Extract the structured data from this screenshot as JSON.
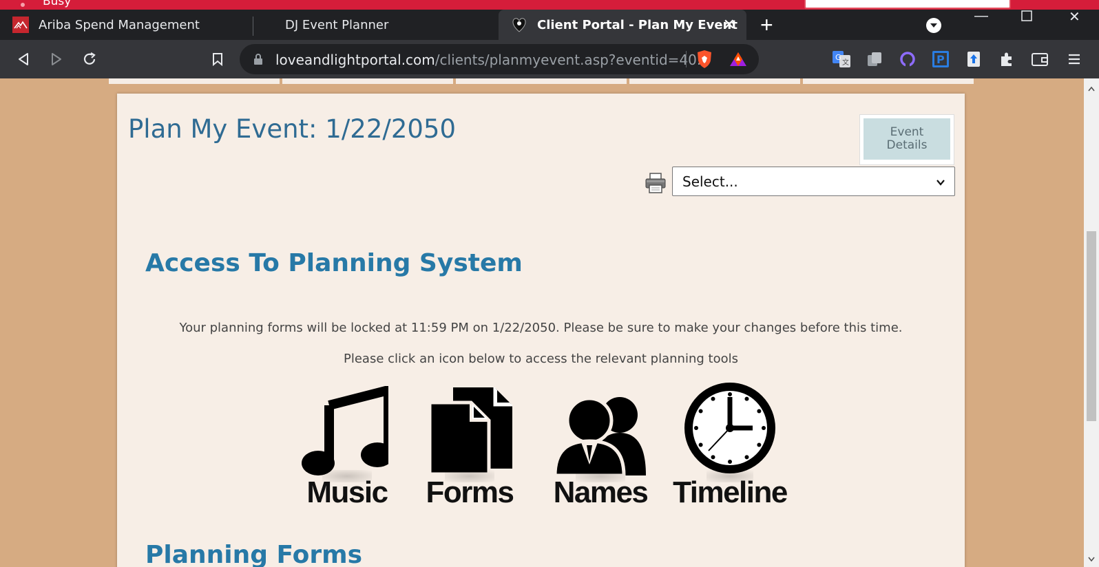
{
  "os_bar": {
    "busy_label": "Busy"
  },
  "tabs": [
    {
      "label": "Ariba Spend Management",
      "icon": "ariba-favicon"
    },
    {
      "label": "DJ Event Planner",
      "icon": "none"
    },
    {
      "label": "Client Portal - Plan My Event",
      "icon": "portal-favicon",
      "active": true
    }
  ],
  "toolbar": {
    "url_host": "loveandlightportal.com",
    "url_path": "/clients/planmyevent.asp?eventid=40..."
  },
  "page": {
    "title": "Plan My Event: 1/22/2050",
    "event_details_button": "Event Details",
    "select_value": "Select...",
    "section_title": "Access To Planning System",
    "lock_message": "Your planning forms will be locked at 11:59 PM on 1/22/2050. Please be sure to make your changes before this time.",
    "click_message": "Please click an icon below to access the relevant planning tools",
    "tools": [
      {
        "label": "Music",
        "icon": "music-note-icon"
      },
      {
        "label": "Forms",
        "icon": "documents-icon"
      },
      {
        "label": "Names",
        "icon": "people-icon"
      },
      {
        "label": "Timeline",
        "icon": "clock-icon"
      }
    ],
    "next_section_title": "Planning Forms"
  },
  "colors": {
    "page_bg": "#d6ab82",
    "content_bg": "#f7eee6",
    "title_blue": "#2f6b93",
    "section_blue": "#2779a7",
    "os_red": "#d51d3a"
  }
}
